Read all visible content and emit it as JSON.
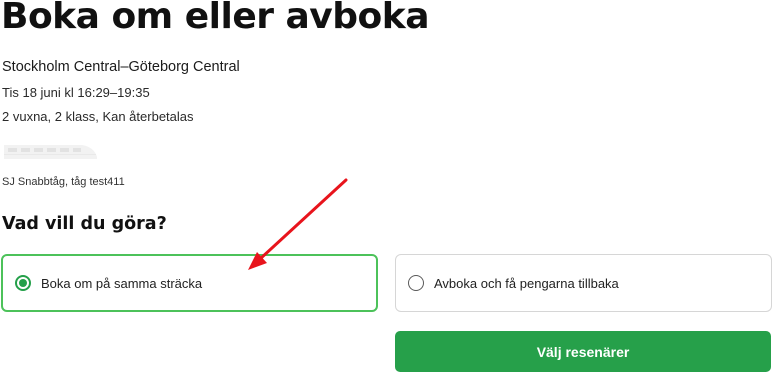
{
  "page": {
    "title": "Boka om eller avboka"
  },
  "trip": {
    "route": "Stockholm Central–Göteborg Central",
    "datetime": "Tis 18 juni kl 16:29–19:35",
    "passengers": "2 vuxna, 2 klass, Kan återbetalas",
    "train_label": "SJ Snabbtåg, tåg test411",
    "train_icon": "train-image"
  },
  "question": {
    "label": "Vad vill du göra?",
    "options": [
      {
        "label": "Boka om på samma sträcka",
        "selected": true
      },
      {
        "label": "Avboka och få pengarna tillbaka",
        "selected": false
      }
    ]
  },
  "actions": {
    "primary_label": "Välj resenärer"
  },
  "colors": {
    "accent": "#26a04a",
    "selected_border": "#4cc25a",
    "annotation_arrow": "#e8141c"
  }
}
